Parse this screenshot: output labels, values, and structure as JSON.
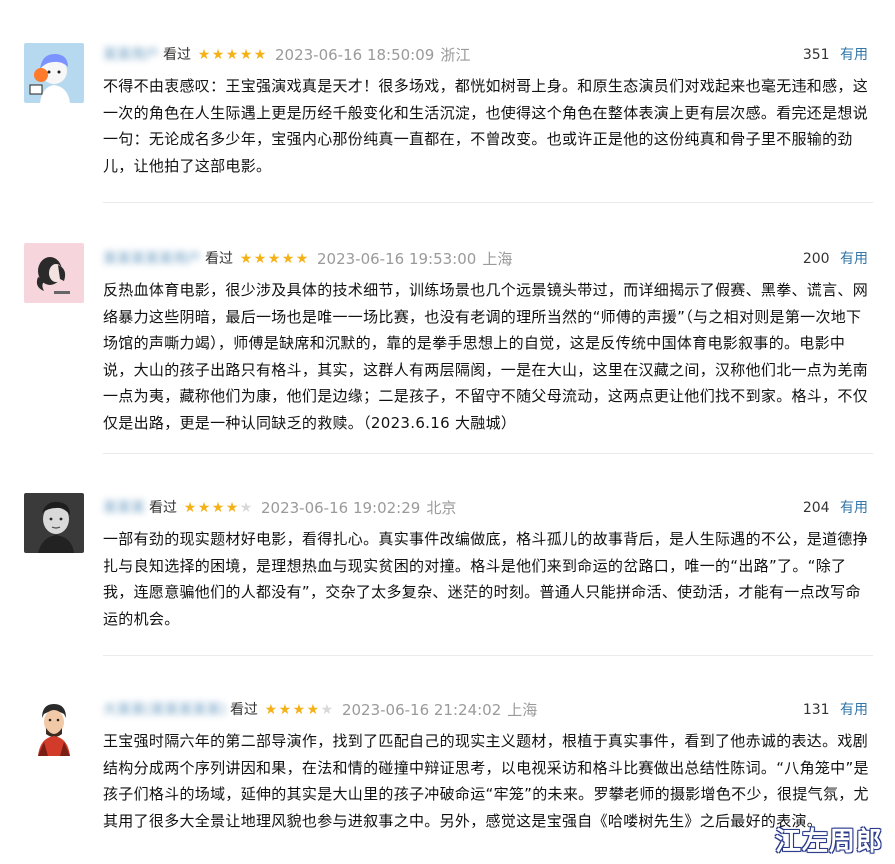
{
  "reviews": [
    {
      "username": "某某用户",
      "watched": "看过",
      "stars": 5,
      "time": "2023-06-16 18:50:09",
      "location": "浙江",
      "votes": "351",
      "useful": "有用",
      "content": "不得不由衷感叹：王宝强演戏真是天才！很多场戏，都恍如树哥上身。和原生态演员们对戏起来也毫无违和感，这一次的角色在人生际遇上更是历经千般变化和生活沉淀，也使得这个角色在整体表演上更有层次感。看完还是想说一句：无论成名多少年，宝强内心那份纯真一直都在，不曾改变。也或许正是他的这份纯真和骨子里不服输的劲儿，让他拍了这部电影。"
    },
    {
      "username": "某某某某某用户",
      "watched": "看过",
      "stars": 5,
      "time": "2023-06-16 19:53:00",
      "location": "上海",
      "votes": "200",
      "useful": "有用",
      "content": "反热血体育电影，很少涉及具体的技术细节，训练场景也几个远景镜头带过，而详细揭示了假赛、黑拳、谎言、网络暴力这些阴暗，最后一场也是唯一一场比赛，也没有老调的理所当然的“师傅的声援”（与之相对则是第一次地下场馆的声嘶力竭），师傅是缺席和沉默的，靠的是拳手思想上的自觉，这是反传统中国体育电影叙事的。电影中说，大山的孩子出路只有格斗，其实，这群人有两层隔阂，一是在大山，这里在汉藏之间，汉称他们北一点为羌南一点为夷，藏称他们为康，他们是边缘；二是孩子，不留守不随父母流动，这两点更让他们找不到家。格斗，不仅仅是出路，更是一种认同缺乏的救赎。（2023.6.16 大融城）"
    },
    {
      "username": "某某某",
      "watched": "看过",
      "stars": 4,
      "time": "2023-06-16 19:02:29",
      "location": "北京",
      "votes": "204",
      "useful": "有用",
      "content": "一部有劲的现实题材好电影，看得扎心。真实事件改编做底，格斗孤儿的故事背后，是人生际遇的不公，是道德挣扎与良知选择的困境，是理想热血与现实贫困的对撞。格斗是他们来到命运的岔路口，唯一的“出路”了。“除了我，连愿意骗他们的人都没有”，交杂了太多复杂、迷茫的时刻。普通人只能拼命活、使劲活，才能有一点改写命运的机会。"
    },
    {
      "username": "大某某(某某某某某)",
      "watched": "看过",
      "stars": 4,
      "time": "2023-06-16 21:24:02",
      "location": "上海",
      "votes": "131",
      "useful": "有用",
      "content": "王宝强时隔六年的第二部导演作，找到了匹配自己的现实主义题材，根植于真实事件，看到了他赤诚的表达。戏剧结构分成两个序列讲因和果，在法和情的碰撞中辩证思考，以电视采访和格斗比赛做出总结性陈词。“八角笼中”是孩子们格斗的场域，延伸的其实是大山里的孩子冲破命运“牢笼”的未来。罗攀老师的摄影增色不少，很提气氛，尤其用了很多大全景让地理风貌也参与进叙事之中。另外，感觉这是宝强自《哈喽树先生》之后最好的表演。"
    }
  ],
  "watermark": "江左周郎",
  "star_color": "#f5b118",
  "link_color": "#3377aa"
}
